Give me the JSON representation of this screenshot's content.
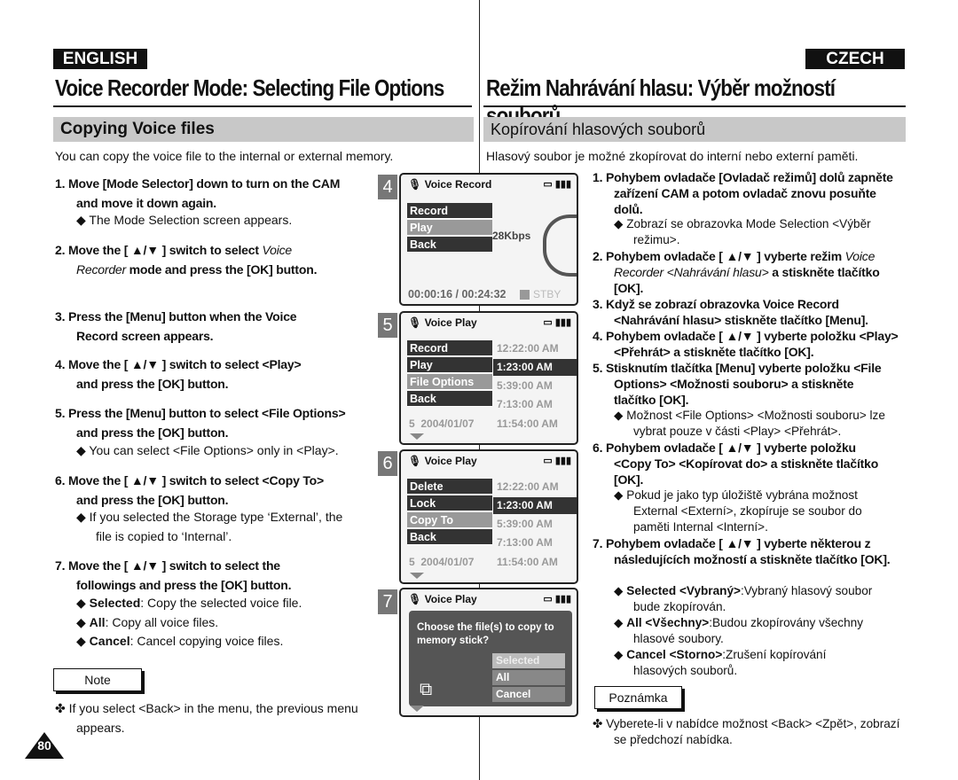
{
  "header": {
    "english": "ENGLISH",
    "czech": "CZECH",
    "title_en": "Voice Recorder Mode: Selecting File Options",
    "title_cz": "Režim Nahrávání hlasu: Výběr možností souborů"
  },
  "en": {
    "section": "Copying Voice files",
    "intro": "You can copy the voice file to the internal or external memory.",
    "steps": [
      {
        "n": "1.",
        "text": "Move [Mode Selector] down to turn on the CAM and move it down again."
      },
      {
        "bullet": "The Mode Selection screen appears."
      },
      {
        "n": "2.",
        "pre": "Move the [ ▲/▼ ] switch to select ",
        "em": "Voice Recorder",
        "post": " mode and press the [OK] button."
      },
      {
        "n": "3.",
        "text": "Press the [Menu] button when the Voice Record screen appears."
      },
      {
        "n": "4.",
        "text": "Move the [ ▲/▼ ] switch to select <Play> and press the [OK] button."
      },
      {
        "n": "5.",
        "text": "Press the [Menu] button to select <File Options> and press the [OK] button."
      },
      {
        "bullet": "You can select <File Options> only in <Play>."
      },
      {
        "n": "6.",
        "text": "Move the [ ▲/▼ ] switch to select <Copy To> and press the [OK] button."
      },
      {
        "bullet": "If you selected the Storage type ‘External’, the file is copied to ‘Internal’."
      },
      {
        "n": "7.",
        "text": "Move the [ ▲/▼ ] switch to select the followings and press the [OK] button."
      },
      {
        "bold": "Selected",
        "text": ": Copy the selected voice file."
      },
      {
        "bold": "All",
        "text": ": Copy all voice files."
      },
      {
        "bold": "Cancel",
        "text": ": Cancel copying voice files."
      }
    ],
    "note_label": "Note",
    "note": "If you select <Back> in the menu, the previous menu appears.",
    "page": "80"
  },
  "cz": {
    "section": "Kopírování hlasových souborů",
    "intro": "Hlasový soubor je možné zkopírovat do interní nebo externí paměti.",
    "steps": [
      {
        "n": "1.",
        "text": "Pohybem ovladače [Ovladač režimů] dolů zapněte zařízení CAM a potom ovladač znovu posuňte dolů."
      },
      {
        "bullet": "Zobrazí se obrazovka Mode Selection <Výběr režimu>."
      },
      {
        "n": "2.",
        "pre": "Pohybem ovladače [ ▲/▼ ] vyberte režim ",
        "em": "Voice Recorder <Nahrávání hlasu>",
        "post": " a stiskněte tlačítko [OK]."
      },
      {
        "n": "3.",
        "text": "Když se zobrazí obrazovka Voice Record <Nahrávání hlasu> stiskněte tlačítko [Menu]."
      },
      {
        "n": "4.",
        "text": "Pohybem ovladače [ ▲/▼ ] vyberte položku <Play> <Přehrát> a stiskněte tlačítko [OK]."
      },
      {
        "n": "5.",
        "text": "Stisknutím tlačítka [Menu] vyberte položku <File Options> <Možnosti souboru> a stiskněte tlačítko [OK]."
      },
      {
        "bullet": "Možnost <File Options> <Možnosti souboru> lze vybrat pouze v části <Play> <Přehrát>."
      },
      {
        "n": "6.",
        "text": "Pohybem ovladače [ ▲/▼ ] vyberte položku <Copy To> <Kopírovat do> a stiskněte tlačítko [OK]."
      },
      {
        "bullet": "Pokud je jako typ úložiště vybrána možnost External <Externí>, zkopíruje se soubor do paměti Internal <Interní>."
      },
      {
        "n": "7.",
        "text": "Pohybem ovladače [ ▲/▼ ] vyberte některou z následujících možností a stiskněte tlačítko [OK]."
      },
      {
        "bold": "Selected <Vybraný>",
        "text": ":Vybraný hlasový soubor bude zkopírován."
      },
      {
        "bold": "All <Všechny>",
        "text": ":Budou zkopírovány všechny hlasové soubory."
      },
      {
        "bold": "Cancel <Storno>",
        "text": ":Zrušení kopírování hlasových souborů."
      }
    ],
    "note_label": "Poznámka",
    "note": "Vyberete-li v nabídce možnost <Back> <Zpět>, zobrazí se předchozí nabídka."
  },
  "screens": {
    "s4": {
      "num": "4",
      "title": "Voice Record",
      "menu": [
        "Record",
        "Play",
        "Back"
      ],
      "bitrate": "28Kbps",
      "time": "00:00:16 / 00:24:32",
      "status": "STBY"
    },
    "s5": {
      "num": "5",
      "title": "Voice Play",
      "menu": [
        "Record",
        "Play",
        "File Options",
        "Back"
      ],
      "times": [
        "12:22:00 AM",
        "1:23:00 AM",
        "5:39:00 AM",
        "7:13:00 AM",
        "11:54:00 AM"
      ],
      "last_index": "5",
      "last_date": "2004/01/07"
    },
    "s6": {
      "num": "6",
      "title": "Voice Play",
      "menu": [
        "Delete",
        "Lock",
        "Copy To",
        "Back"
      ],
      "times": [
        "12:22:00 AM",
        "1:23:00 AM",
        "5:39:00 AM",
        "7:13:00 AM",
        "11:54:00 AM"
      ],
      "last_index": "5",
      "last_date": "2004/01/07"
    },
    "s7": {
      "num": "7",
      "title": "Voice Play",
      "prompt": "Choose the file(s) to copy to memory stick?",
      "options": [
        "Selected",
        "All",
        "Cancel"
      ]
    }
  },
  "bullet_glyph": "◆",
  "note_glyph": "✤"
}
